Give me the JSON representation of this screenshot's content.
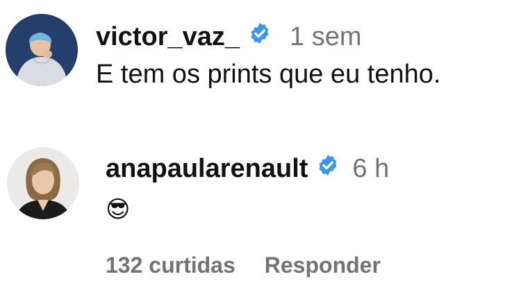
{
  "comments": [
    {
      "username": "victor_vaz_",
      "verified": true,
      "time": "1 sem",
      "text": "E tem os prints que eu tenho."
    },
    {
      "username": "anapaularenault",
      "verified": true,
      "time": "6 h",
      "text": "😎",
      "likes_label": "132 curtidas",
      "reply_label": "Responder"
    }
  ],
  "colors": {
    "verified_badge": "#3897f0",
    "secondary_text": "#737373",
    "primary_text": "#111111"
  }
}
